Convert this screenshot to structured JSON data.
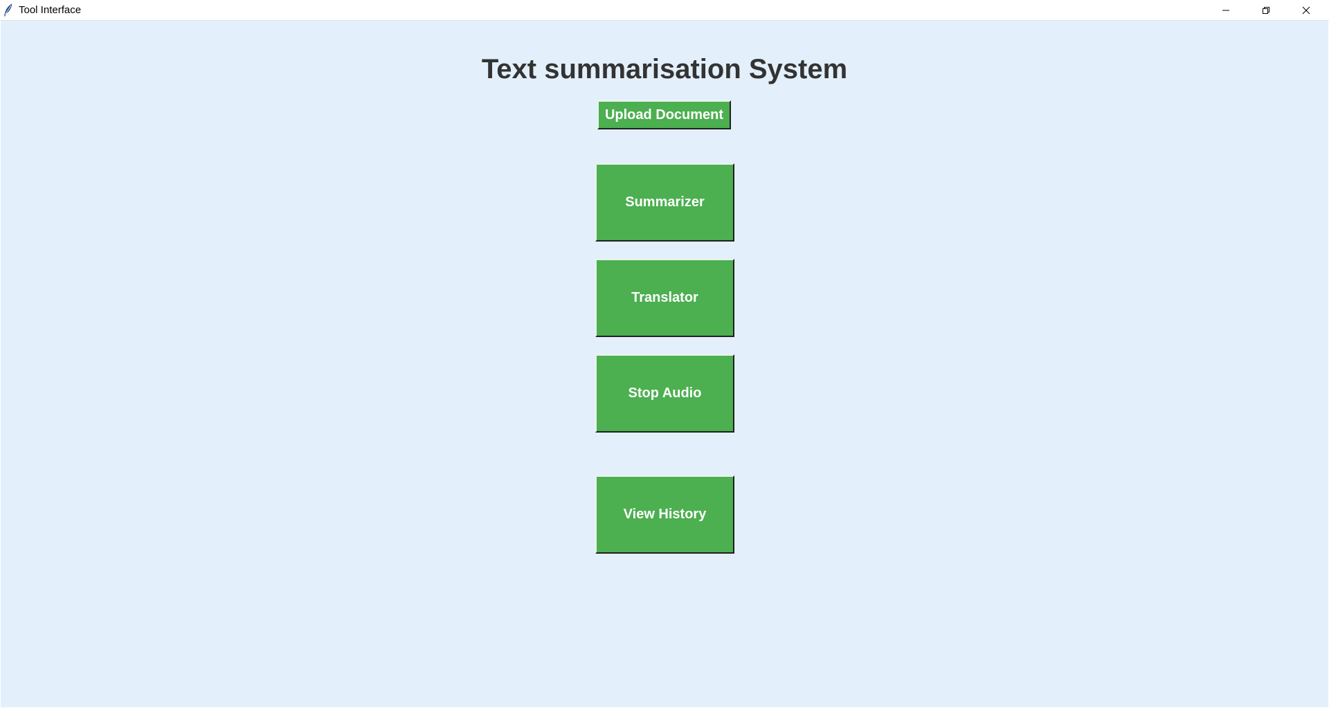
{
  "window": {
    "title": "Tool Interface",
    "app_icon": "feather-icon",
    "controls": [
      "minimize-icon",
      "restore-icon",
      "close-icon"
    ]
  },
  "main": {
    "heading": "Text summarisation System",
    "buttons": {
      "upload": "Upload Document",
      "summarizer": "Summarizer",
      "translator": "Translator",
      "stop_audio": "Stop Audio",
      "view_history": "View History"
    }
  },
  "colors": {
    "background": "#e3f0fc",
    "button": "#4caf50",
    "button_text": "#ffffff",
    "heading_text": "#333333"
  }
}
